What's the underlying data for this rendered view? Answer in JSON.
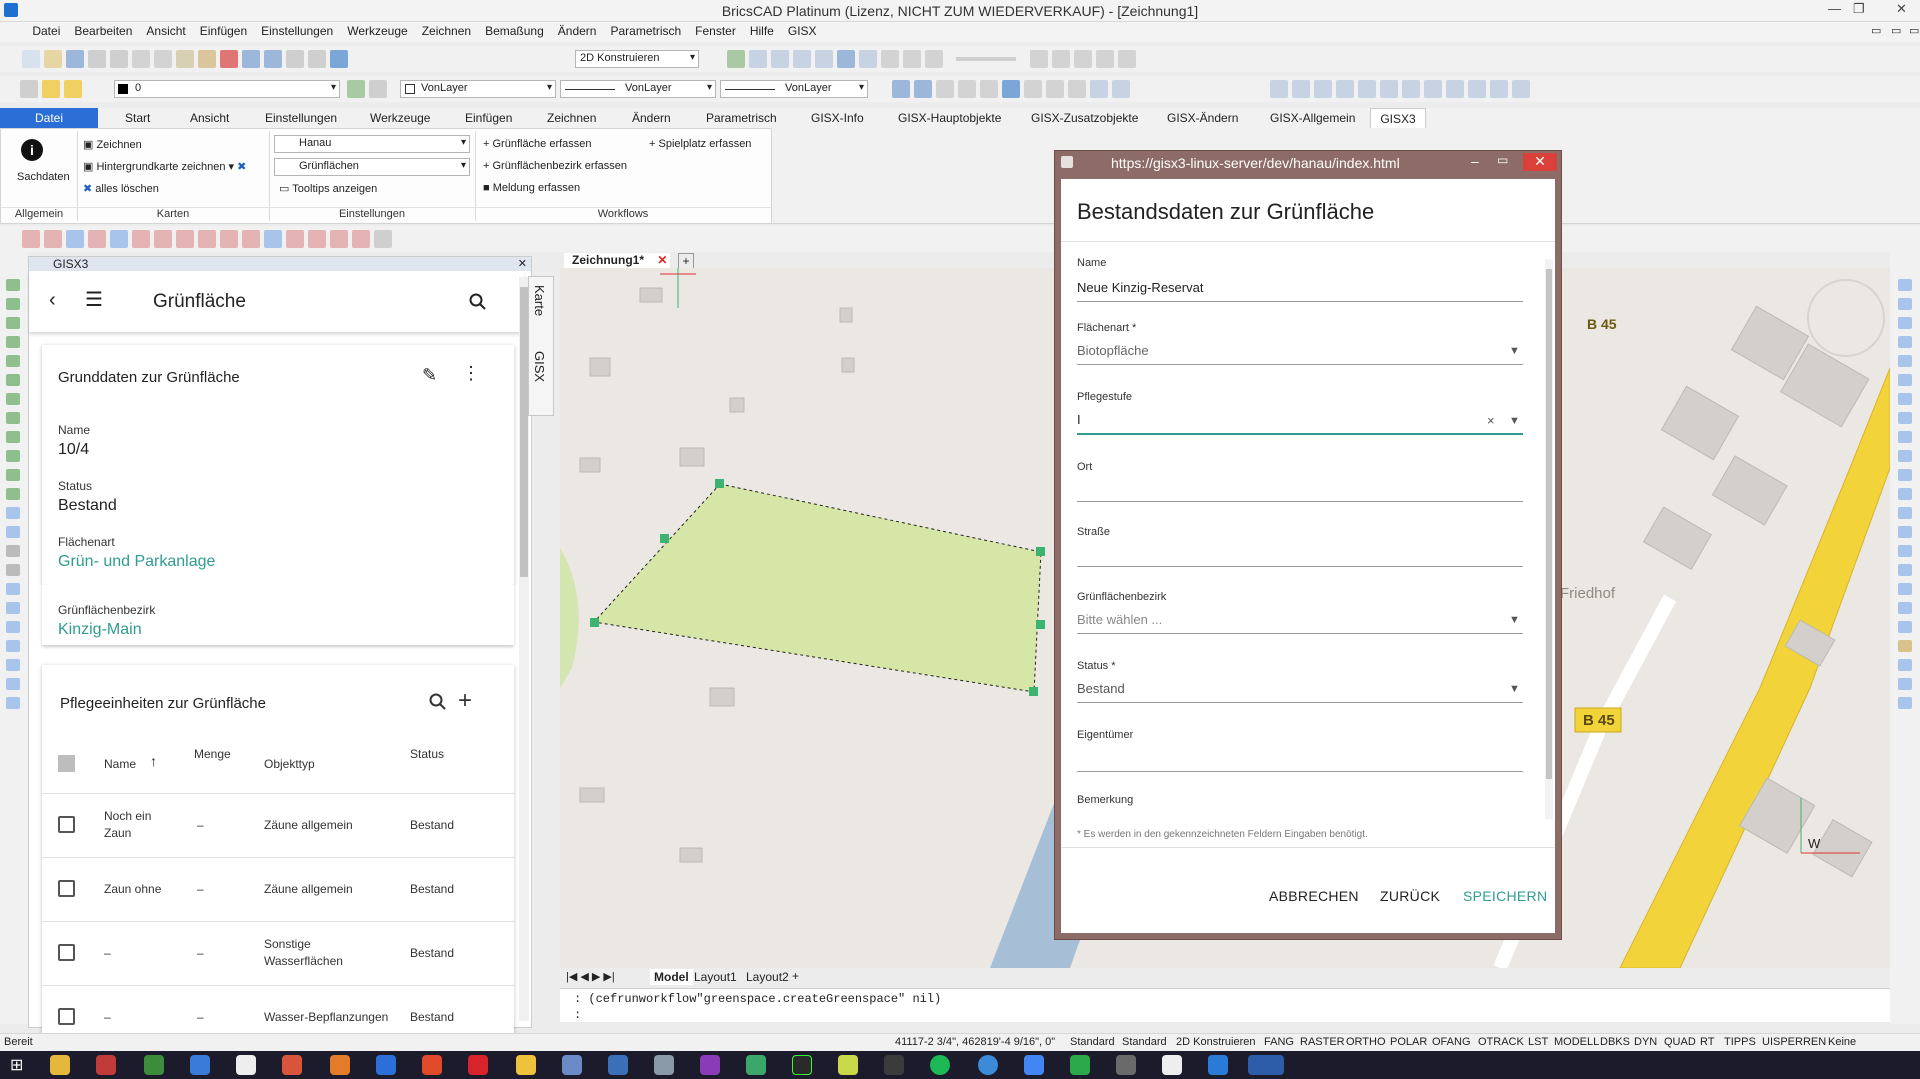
{
  "window": {
    "title": "BricsCAD Platinum (Lizenz, NICHT ZUM WIEDERVERKAUF) - [Zeichnung1]"
  },
  "menu": [
    "Datei",
    "Bearbeiten",
    "Ansicht",
    "Einfügen",
    "Einstellungen",
    "Werkzeuge",
    "Zeichnen",
    "Bemaßung",
    "Ändern",
    "Parametrisch",
    "Fenster",
    "Hilfe",
    "GISX"
  ],
  "toolbar": {
    "workspace": "2D Konstruieren",
    "layer": "0",
    "color": "VonLayer",
    "linetype": "VonLayer",
    "lineweight": "VonLayer"
  },
  "ribbon": {
    "tabs": [
      "Datei",
      "Start",
      "Ansicht",
      "Einstellungen",
      "Werkzeuge",
      "Einfügen",
      "Zeichnen",
      "Ändern",
      "Parametrisch",
      "GISX-Info",
      "GISX-Hauptobjekte",
      "GISX-Zusatzobjekte",
      "GISX-Ändern",
      "GISX-Allgemein",
      "GISX3"
    ],
    "sachdaten": "Sachdaten",
    "karten_items": [
      "Zeichnen",
      "Hintergrundkarte zeichnen",
      "alles löschen"
    ],
    "einstellungen_selects": [
      "Hanau",
      "Grünflächen"
    ],
    "tooltips": "Tooltips anzeigen",
    "workflow_items": [
      "Grünfläche erfassen",
      "Grünflächenbezirk erfassen",
      "Meldung erfassen"
    ],
    "spielplatz": "Spielplatz erfassen",
    "groups": [
      "Allgemein",
      "Karten",
      "Einstellungen",
      "Workflows"
    ]
  },
  "panel": {
    "header": "GISX3",
    "title": "Grünfläche",
    "side_tabs": [
      "Karte",
      "GISX"
    ],
    "grund_title": "Grunddaten zur Grünfläche",
    "fields": [
      {
        "label": "Name",
        "value": "10/4"
      },
      {
        "label": "Status",
        "value": "Bestand"
      },
      {
        "label": "Flächenart",
        "value": "Grün- und Parkanlage"
      },
      {
        "label": "Grünflächenbezirk",
        "value": "Kinzig-Main"
      }
    ],
    "pflege_title": "Pflegeeinheiten zur Grünfläche",
    "columns": [
      "Name",
      "Menge",
      "Objekttyp",
      "Status"
    ],
    "rows": [
      {
        "name": "Noch ein Zaun",
        "menge": "–",
        "typ": "Zäune allgemein",
        "status": "Bestand"
      },
      {
        "name": "Zaun ohne",
        "menge": "–",
        "typ": "Zäune allgemein",
        "status": "Bestand"
      },
      {
        "name": "–",
        "menge": "–",
        "typ": "Sonstige Wasserflächen",
        "status": "Bestand"
      },
      {
        "name": "–",
        "menge": "–",
        "typ": "Wasser-Bepflanzungen",
        "status": "Bestand"
      }
    ]
  },
  "drawing": {
    "tab": "Zeichnung1*",
    "layouts": [
      "Model",
      "Layout1",
      "Layout2"
    ],
    "map_labels": [
      "B 45",
      "B 45",
      "Friedhof",
      "W"
    ]
  },
  "dialog": {
    "url": "https://gisx3-linux-server/dev/hanau/index.html",
    "title": "Bestandsdaten zur Grünfläche",
    "fields": [
      {
        "label": "Name",
        "value": "Neue Kinzig-Reservat"
      },
      {
        "label": "Flächenart *",
        "value": "Biotopfläche"
      },
      {
        "label": "Pflegestufe",
        "value": "I"
      },
      {
        "label": "Ort",
        "value": ""
      },
      {
        "label": "Straße",
        "value": ""
      },
      {
        "label": "Grünflächenbezirk",
        "value": "Bitte wählen ..."
      },
      {
        "label": "Status *",
        "value": "Bestand"
      },
      {
        "label": "Eigentümer",
        "value": ""
      },
      {
        "label": "Bemerkung",
        "value": ""
      }
    ],
    "hint": "* Es werden in den gekennzeichneten Feldern Eingaben benötigt.",
    "buttons": [
      "ABBRECHEN",
      "ZURÜCK",
      "SPEICHERN"
    ]
  },
  "command": {
    "history": ": (cefrunworkflow\"greenspace.createGreenspace\" nil)",
    "prompt": ":"
  },
  "status": {
    "ready": "Bereit",
    "coords": "41117-2 3/4\", 462819'-4 9/16\", 0\"",
    "toggles": [
      "Standard",
      "Standard",
      "2D Konstruieren",
      "FANG",
      "RASTER",
      "ORTHO",
      "POLAR",
      "OFANG",
      "OTRACK",
      "LST",
      "MODELL",
      "DBKS",
      "DYN",
      "QUAD",
      "RT",
      "TIPPS",
      "UISPERREN",
      "Keine"
    ]
  },
  "colors": {
    "accent": "#2f9d8f",
    "ribbon_tab_active": "#2b6fd6",
    "polygon_fill": "#d6e6a6",
    "dialog_frame": "#8d6b67",
    "road": "#f2d43a"
  }
}
